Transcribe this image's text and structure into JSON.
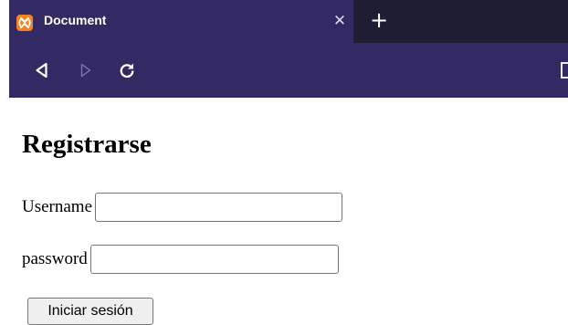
{
  "browser": {
    "tab_title": "Document",
    "tab_close_glyph": "✕",
    "new_tab_glyph": "+",
    "favicon": "xampp-logo-icon",
    "colors": {
      "tabstrip": "#1f1d33",
      "toolbar": "#342a63",
      "favicon": "#f58220"
    },
    "nav_icons": [
      "back-icon",
      "forward-icon",
      "reload-icon",
      "reader-view-icon"
    ]
  },
  "page": {
    "title": "Registrarse",
    "username_label": "Username",
    "username_value": "",
    "password_label": "password",
    "password_value": "",
    "submit_label": "Iniciar sesión"
  }
}
